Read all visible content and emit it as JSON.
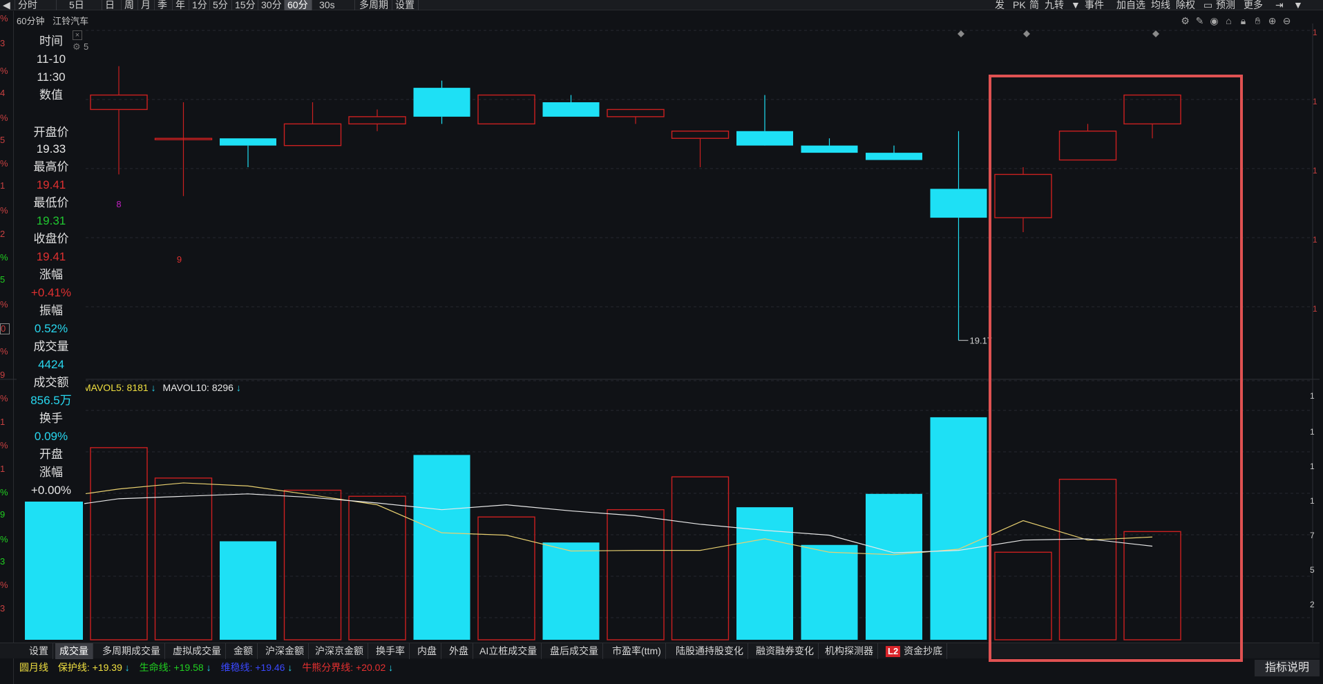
{
  "toolbar": {
    "left_items": [
      "分时",
      "5日",
      "日",
      "周",
      "月",
      "季",
      "年",
      "1分",
      "5分",
      "15分",
      "30分",
      "60分",
      "30s",
      "多周期",
      "设置"
    ],
    "active_item": "60分",
    "right_items": [
      "发",
      "PK",
      "简",
      "九转",
      "事件",
      "加自选",
      "均线",
      "除权",
      "预测",
      "更多"
    ]
  },
  "chart_header": {
    "period": "60分钟",
    "stock": "江铃汽车"
  },
  "info_panel": {
    "time_label": "时间",
    "date": "11-10",
    "time": "11:30",
    "value_label": "数值",
    "open_label": "开盘价",
    "open_value": "19.33",
    "high_label": "最高价",
    "high_value": "19.41",
    "low_label": "最低价",
    "low_value": "19.31",
    "close_label": "收盘价",
    "close_value": "19.41",
    "change_label": "涨幅",
    "change_value": "+0.41%",
    "amplitude_label": "振幅",
    "amplitude_value": "0.52%",
    "volume_label": "成交量",
    "volume_value": "4424",
    "amount_label": "成交额",
    "amount_value": "856.5万",
    "turnover_label": "换手",
    "turnover_value": "0.09%",
    "open_chg_label1": "开盘",
    "open_chg_label2": "涨幅",
    "open_chg_value": "+0.00%",
    "close_icon": "close-icon",
    "gear_icon": "gear-icon",
    "extra_digit": "5"
  },
  "chart_icons": [
    "gear-icon",
    "pencil-icon",
    "eye-icon",
    "basket-icon",
    "lock-icon",
    "hand-icon",
    "zoom-in-icon",
    "zoom-out-icon"
  ],
  "annotations": {
    "low_marker": "19.17",
    "mark_8": "8",
    "mark_9": "9"
  },
  "volume_legend": {
    "mavol5_label": "MAVOL5:",
    "mavol5_value": "8181",
    "mavol10_label": "MAVOL10:",
    "mavol10_value": "8296"
  },
  "bottom_tabs": [
    "设置",
    "成交量",
    "多周期成交量",
    "虚拟成交量",
    "金额",
    "沪深金额",
    "沪深京金额",
    "换手率",
    "内盘",
    "外盘",
    "AI立桩成交量",
    "盘后成交量",
    "市盈率(ttm)",
    "陆股通持股变化",
    "融资融券变化",
    "机构探测器",
    "资金抄底"
  ],
  "active_tab": "成交量",
  "l2_badge": "L2",
  "indicator_line": {
    "name": "圆月线",
    "protect_label": "保护线:",
    "protect_value": "+19.39",
    "life_label": "生命线:",
    "life_value": "+19.58",
    "maintain_label": "维稳线:",
    "maintain_value": "+19.46",
    "bull_label": "牛熊分界线:",
    "bull_value": "+20.02"
  },
  "help_button": "指标说明",
  "colors": {
    "up": "#cc2020",
    "down": "#1ee0f5",
    "yellow": "#f0e040",
    "green": "#20d020",
    "highlight": "#e05252"
  },
  "chart_data": {
    "type": "candlestick",
    "title": "",
    "xlabel": "",
    "ylabel": "",
    "candles": [
      {
        "open": 19.5,
        "high": 19.56,
        "low": 19.41,
        "close": 19.52
      },
      {
        "open": 19.46,
        "high": 19.51,
        "low": 19.38,
        "close": 19.46
      },
      {
        "open": 19.46,
        "high": 19.46,
        "low": 19.42,
        "close": 19.45
      },
      {
        "open": 19.45,
        "high": 19.51,
        "low": 19.45,
        "close": 19.48
      },
      {
        "open": 19.48,
        "high": 19.5,
        "low": 19.47,
        "close": 19.49
      },
      {
        "open": 19.53,
        "high": 19.54,
        "low": 19.48,
        "close": 19.49
      },
      {
        "open": 19.48,
        "high": 19.52,
        "low": 19.48,
        "close": 19.52
      },
      {
        "open": 19.51,
        "high": 19.52,
        "low": 19.49,
        "close": 19.49
      },
      {
        "open": 19.49,
        "high": 19.5,
        "low": 19.48,
        "close": 19.5
      },
      {
        "open": 19.46,
        "high": 19.47,
        "low": 19.42,
        "close": 19.47
      },
      {
        "open": 19.47,
        "high": 19.52,
        "low": 19.46,
        "close": 19.45
      },
      {
        "open": 19.45,
        "high": 19.46,
        "low": 19.44,
        "close": 19.44
      },
      {
        "open": 19.44,
        "high": 19.45,
        "low": 19.44,
        "close": 19.43
      },
      {
        "open": 19.39,
        "high": 19.47,
        "low": 19.18,
        "close": 19.35
      },
      {
        "open": 19.35,
        "high": 19.42,
        "low": 19.33,
        "close": 19.41
      },
      {
        "open": 19.43,
        "high": 19.48,
        "low": 19.43,
        "close": 19.47
      },
      {
        "open": 19.48,
        "high": 19.52,
        "low": 19.46,
        "close": 19.52
      }
    ],
    "volume": [
      15800,
      13300,
      8100,
      12300,
      11800,
      15200,
      10100,
      8000,
      10700,
      13400,
      10900,
      7800,
      12000,
      18300,
      7200,
      13200,
      8900
    ],
    "mavol5": [
      12400,
      12900,
      12650,
      11900,
      11100,
      8800,
      8600,
      7300,
      7350,
      7350,
      8300,
      7200,
      7000,
      7450,
      9800,
      8200,
      8450
    ],
    "mavol10": [
      11600,
      11800,
      12000,
      11700,
      11250,
      10700,
      11100,
      10600,
      10200,
      9500,
      9000,
      8600,
      7150,
      7350,
      8200,
      8300,
      7700
    ]
  }
}
